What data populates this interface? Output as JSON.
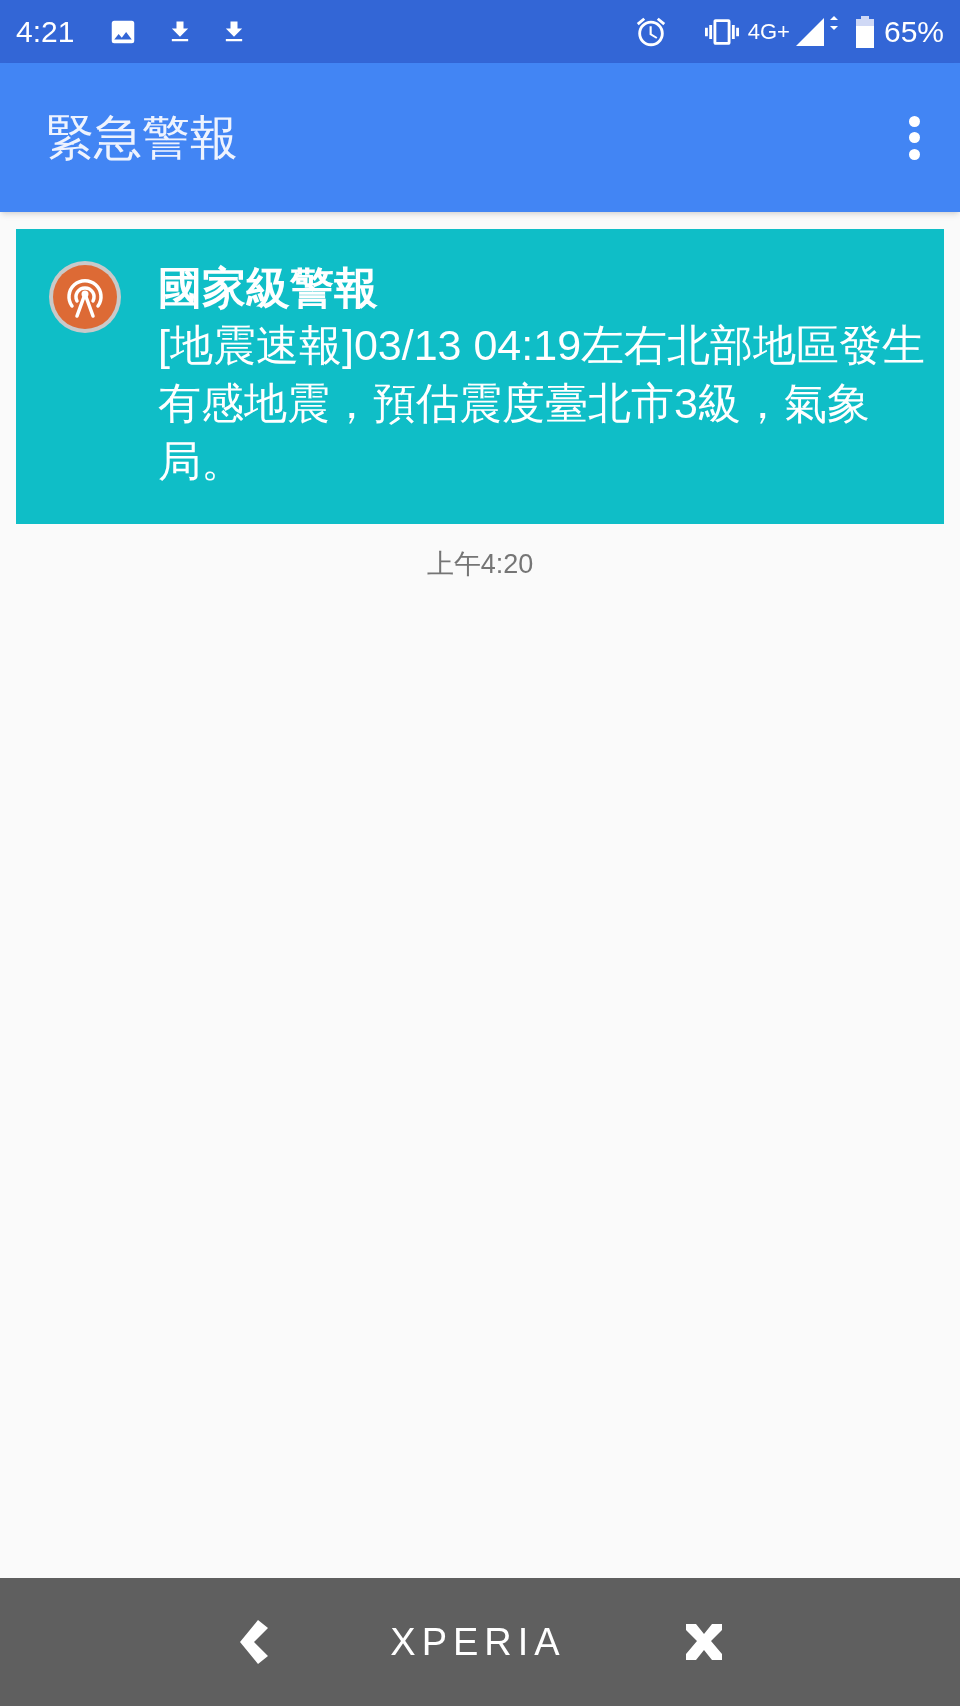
{
  "status_bar": {
    "time": "4:21",
    "network": "4G+",
    "battery": "65%"
  },
  "app_bar": {
    "title": "緊急警報"
  },
  "alerts": [
    {
      "title": "國家級警報",
      "message": "[地震速報]03/13 04:19左右北部地區發生有感地震，預估震度臺北市3級，氣象局。",
      "time": "上午4:20"
    }
  ],
  "nav_bar": {
    "logo": "XPERIA"
  }
}
